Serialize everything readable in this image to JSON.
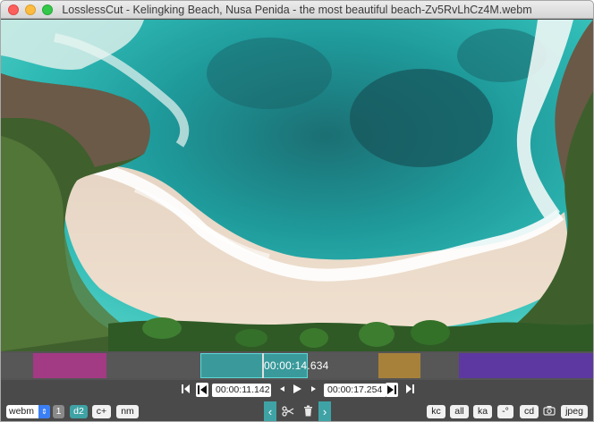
{
  "window": {
    "title": "LosslessCut - Kelingking Beach, Nusa Penida - the most beautiful beach-Zv5RvLhCz4M.webm"
  },
  "timeline": {
    "current_time": "00:00:14.634",
    "segment_colors": [
      "#a33a84",
      "#3a9a9b",
      "#a7813a",
      "#5d38a0"
    ]
  },
  "transport": {
    "cut_start": "00:00:11.142",
    "cut_end": "00:00:17.254",
    "icons": [
      "jump-to-start-icon",
      "set-cut-start-icon",
      "step-back-icon",
      "play-icon",
      "step-forward-icon",
      "set-cut-end-icon",
      "jump-to-end-icon"
    ]
  },
  "bottom": {
    "format_select": "webm",
    "segment_number": "1",
    "d2": "d2",
    "c_plus": "c+",
    "nm": "nm",
    "kc": "kc",
    "all": "all",
    "ka": "ka",
    "minus_degree": "-°",
    "cd": "cd",
    "jpeg": "jpeg"
  }
}
